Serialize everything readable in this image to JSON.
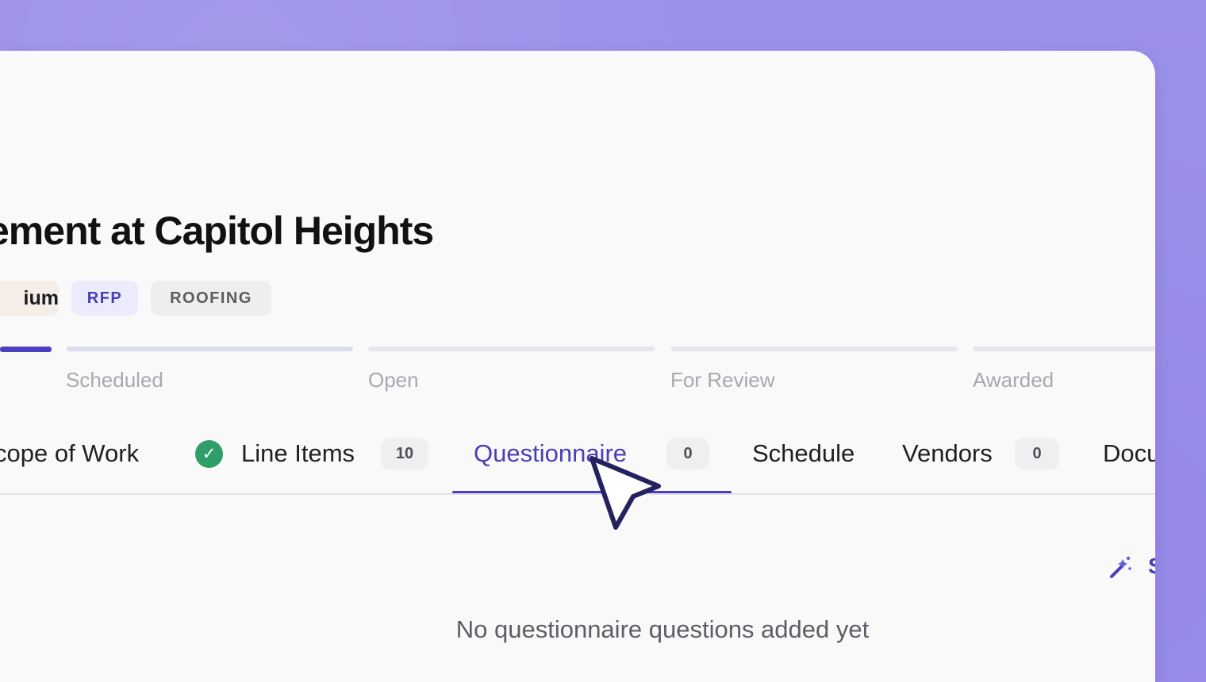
{
  "page": {
    "title": "ement at Capitol Heights"
  },
  "tags": {
    "priority": "ium",
    "type": "RFP",
    "category": "ROOFING"
  },
  "stages": [
    {
      "label": "Scheduled",
      "state": "in-progress"
    },
    {
      "label": "Open",
      "state": "upcoming"
    },
    {
      "label": "For Review",
      "state": "upcoming"
    },
    {
      "label": "Awarded",
      "state": "upcoming"
    }
  ],
  "tabs": {
    "scope_of_work": {
      "label": "cope of Work"
    },
    "line_items": {
      "label": "Line Items",
      "count": "10",
      "completed": true
    },
    "questionnaire": {
      "label": "Questionnaire",
      "count": "0",
      "selected": true
    },
    "schedule": {
      "label": "Schedule"
    },
    "vendors": {
      "label": "Vendors",
      "count": "0"
    },
    "documents": {
      "label": "Docu"
    }
  },
  "actions": {
    "magic_icon": "magic-wand-icon",
    "clipped_label": "S"
  },
  "empty_state": {
    "message": "No questionnaire questions added yet"
  },
  "colors": {
    "backdrop": "#9c91ea",
    "accent": "#4c3fbd",
    "success": "#2f9f6a",
    "panel": "#f9f9fa"
  }
}
